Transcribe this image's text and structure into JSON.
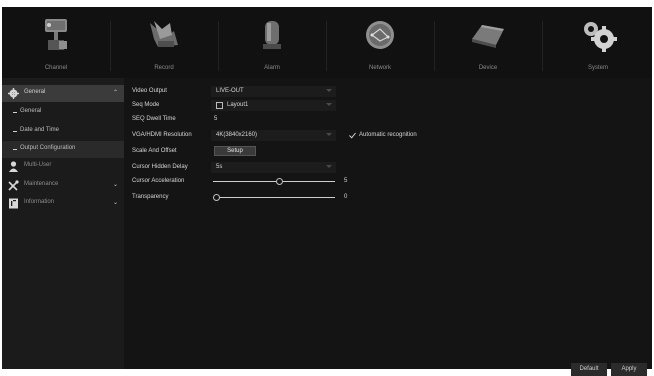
{
  "top_menu": [
    {
      "label": "Channel",
      "icon": "camera-icon"
    },
    {
      "label": "Record",
      "icon": "record-icon"
    },
    {
      "label": "Alarm",
      "icon": "alarm-icon"
    },
    {
      "label": "Network",
      "icon": "network-icon"
    },
    {
      "label": "Device",
      "icon": "device-icon"
    },
    {
      "label": "System",
      "icon": "gears-icon"
    }
  ],
  "sidebar": {
    "sections": [
      {
        "label": "General",
        "icon": "gear-icon",
        "chevron": "⌃"
      },
      {
        "label": "Multi-User",
        "icon": "user-icon"
      },
      {
        "label": "Maintenance",
        "icon": "wrench-icon",
        "chevron": "⌄"
      },
      {
        "label": "Information",
        "icon": "info-icon",
        "chevron": "⌄"
      }
    ],
    "sub_items": [
      "General",
      "Date and Time",
      "Output Configuration"
    ]
  },
  "form": {
    "video_output": {
      "label": "Video Output",
      "value": "LIVE-OUT"
    },
    "seq_mode": {
      "label": "Seq Mode",
      "value": "Layout1"
    },
    "seq_dwell": {
      "label": "SEQ Dwell Time",
      "value": "5"
    },
    "vga_res": {
      "label": "VGA/HDMI Resolution",
      "value": "4K(3840x2160)",
      "auto_label": "Automatic recognition",
      "auto_checked": true
    },
    "scale": {
      "label": "Scale And Offset",
      "button": "Setup"
    },
    "cursor_hidden": {
      "label": "Cursor Hidden Delay",
      "value": "5s"
    },
    "cursor_accel": {
      "label": "Cursor Acceleration",
      "value": "5",
      "level": 0.55
    },
    "transparency": {
      "label": "Transparency",
      "value": "0",
      "level": 0.0
    }
  },
  "buttons": {
    "default": "Default",
    "apply": "Apply"
  },
  "colors": {
    "background": "#151515",
    "sidebar": "#1b1b1b",
    "highlight": "#3b3b3b",
    "text": "#d6d6d6"
  }
}
